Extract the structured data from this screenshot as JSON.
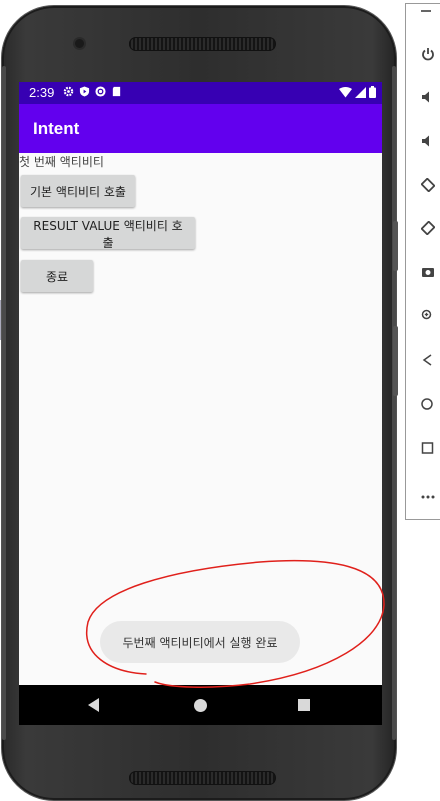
{
  "status_bar": {
    "time": "2:39"
  },
  "app_bar": {
    "title": "Intent"
  },
  "main": {
    "activity_label": "첫 번째 액티비티",
    "buttons": [
      "기본 액티비티 호출",
      "RESULT VALUE 액티비티 호출",
      "종료"
    ]
  },
  "toast": {
    "message": "두번째 액티비티에서 실행 완료"
  },
  "colors": {
    "status_bar": "#3700b3",
    "app_bar": "#6200ee",
    "annotation": "#e0201b"
  },
  "navigation": {
    "icons": [
      "back-icon",
      "home-icon",
      "recents-icon"
    ]
  },
  "emulator_toolbar": {
    "icons": [
      "minimize-icon",
      "power-icon",
      "volume-up-icon",
      "volume-down-icon",
      "rotate-left-icon",
      "rotate-right-icon",
      "camera-icon",
      "zoom-icon",
      "back-icon",
      "home-icon",
      "overview-icon",
      "more-icon"
    ]
  }
}
